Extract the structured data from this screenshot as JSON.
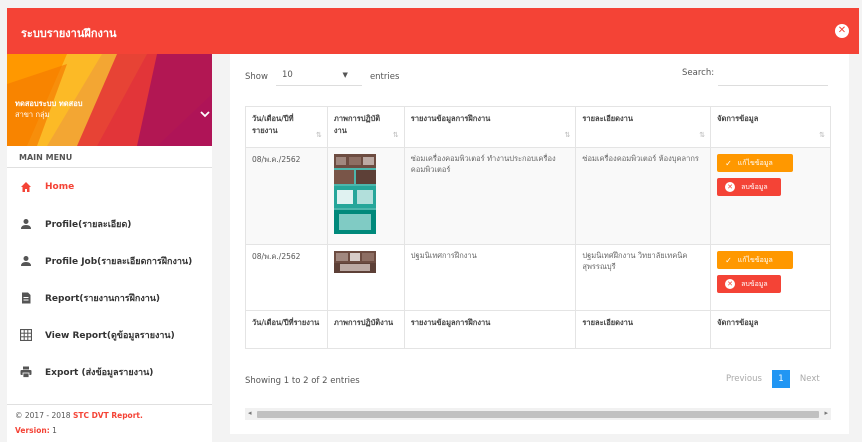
{
  "app": {
    "title": "ระบบรายงานฝึกงาน"
  },
  "user": {
    "name": "ทดสอบระบบ ทดสอบ",
    "dept": "สาขา กลุ่ม"
  },
  "menu": {
    "header": "MAIN MENU",
    "items": [
      {
        "label": "Home",
        "icon": "home-icon",
        "active": true
      },
      {
        "label": "Profile(รายละเอียด)",
        "icon": "person-icon"
      },
      {
        "label": "Profile Job(รายละเอียดการฝึกงาน)",
        "icon": "person-icon"
      },
      {
        "label": "Report(รายงานการฝึกงาน)",
        "icon": "document-icon"
      },
      {
        "label": "View Report(ดูข้อมูลรายงาน)",
        "icon": "table-icon"
      },
      {
        "label": "Export (ส่งข้อมูลรายงาน)",
        "icon": "printer-icon"
      }
    ]
  },
  "footer": {
    "copyright": "© 2017 - 2018",
    "brand": "STC DVT Report.",
    "version_label": "Version:",
    "version": "1"
  },
  "table_controls": {
    "show_label": "Show",
    "show_value": "10",
    "entries_label": "entries",
    "search_label": "Search:"
  },
  "table": {
    "headers": [
      "วัน/เดือน/ปีที่รายงาน",
      "ภาพการปฏิบัติงาน",
      "รายงานข้อมูลการฝึกงาน",
      "รายละเอียดงาน",
      "จัดการข้อมูล"
    ],
    "footer_headers": [
      "วัน/เดือน/ปีที่รายงาน",
      "ภาพการปฏิบัติงาน",
      "รายงานข้อมูลการฝึกงาน",
      "รายละเอียดงาน",
      "จัดการข้อมูล"
    ],
    "rows": [
      {
        "date": "08/พ.ค./2562",
        "report": "ซ่อมเครื่องคอมพิวเตอร์ ทำงานประกอบเครื่องคอมพิวเตอร์",
        "detail": "ซ่อมเครื่องคอมพิวเตอร์ ห้องบุคลากร"
      },
      {
        "date": "08/พ.ค./2562",
        "report": "ปฐมนิเทศการฝึกงาน",
        "detail": "ปฐมนิเทศฝึกงาน วิทยาลัยเทคนิคสุพรรณบุรี"
      }
    ],
    "edit_label": "แก้ไขข้อมูล",
    "delete_label": "ลบข้อมูล"
  },
  "pagination": {
    "info": "Showing 1 to 2 of 2 entries",
    "previous": "Previous",
    "current": "1",
    "next": "Next"
  },
  "colors": {
    "primary": "#f44336",
    "edit": "#ff9800",
    "page_active": "#2196f3"
  }
}
